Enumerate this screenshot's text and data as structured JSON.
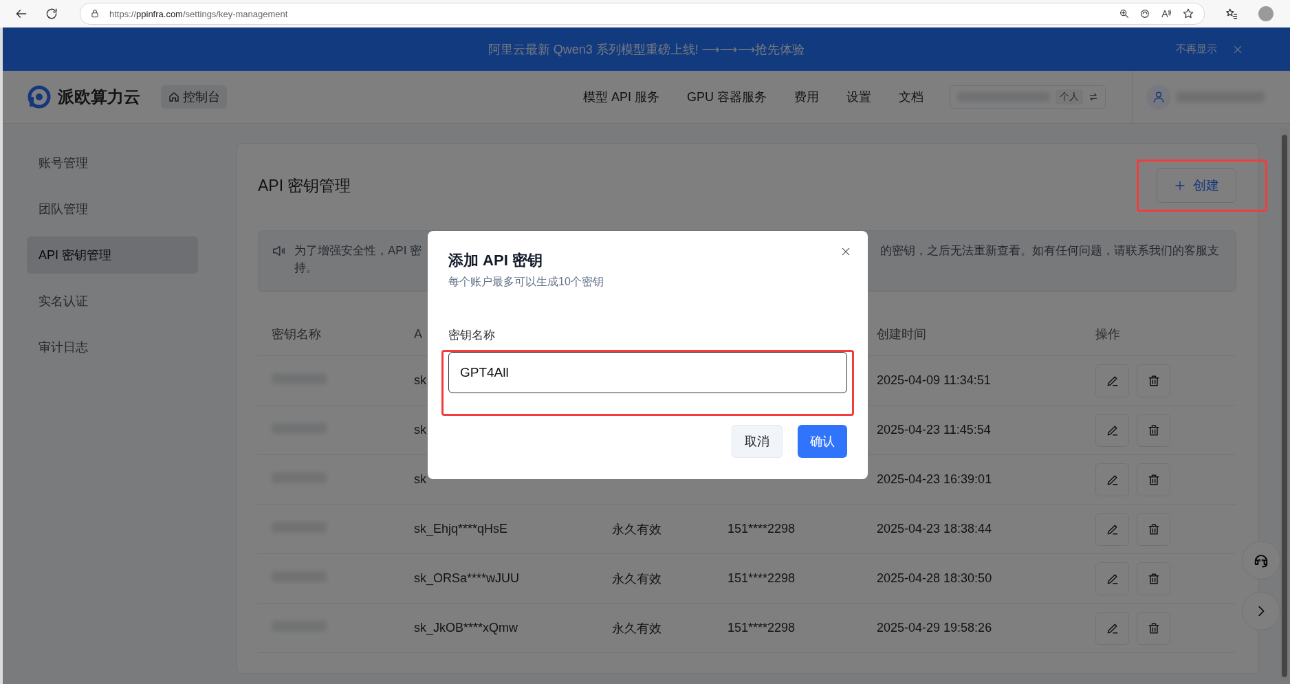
{
  "browser": {
    "url_scheme": "https://",
    "url_domain": "ppinfra.com",
    "url_path": "/settings/key-management"
  },
  "banner": {
    "text": "阿里云最新 Qwen3 系列模型重磅上线! ⟶⟶⟶抢先体验",
    "dismiss": "不再显示"
  },
  "header": {
    "logo": "派欧算力云",
    "console": "控制台",
    "nav": [
      "模型 API 服务",
      "GPU 容器服务",
      "费用",
      "设置",
      "文档"
    ],
    "account_tag": "个人"
  },
  "sidebar": {
    "items": [
      {
        "label": "账号管理",
        "selected": false
      },
      {
        "label": "团队管理",
        "selected": false
      },
      {
        "label": "API 密钥管理",
        "selected": true
      },
      {
        "label": "实名认证",
        "selected": false
      },
      {
        "label": "审计日志",
        "selected": false
      }
    ]
  },
  "page": {
    "title": "API 密钥管理",
    "create_button": "创建",
    "notice": {
      "left": "为了增强安全性，API 密",
      "right": "的密钥，之后无法重新查看。如有任何问题，请联系我们的客服支",
      "continued": "持。"
    }
  },
  "table": {
    "columns": [
      "密钥名称",
      "A",
      "创建时间",
      "操作"
    ],
    "rows": [
      {
        "key": "sk",
        "created": "2025-04-09 11:34:51"
      },
      {
        "key": "sk",
        "created": "2025-04-23 11:45:54"
      },
      {
        "key": "sk",
        "created": "2025-04-23 16:39:01"
      },
      {
        "key": "sk_Ehjq****qHsE",
        "expiry": "永久有效",
        "owner": "151****2298",
        "created": "2025-04-23 18:38:44"
      },
      {
        "key": "sk_ORSa****wJUU",
        "expiry": "永久有效",
        "owner": "151****2298",
        "created": "2025-04-28 18:30:50"
      },
      {
        "key": "sk_JkOB****xQmw",
        "expiry": "永久有效",
        "owner": "151****2298",
        "created": "2025-04-29 19:58:26"
      }
    ]
  },
  "dialog": {
    "title": "添加 API 密钥",
    "subtitle": "每个账户最多可以生成10个密钥",
    "field_label": "密钥名称",
    "field_value": "GPT4All",
    "cancel": "取消",
    "confirm": "确认"
  }
}
